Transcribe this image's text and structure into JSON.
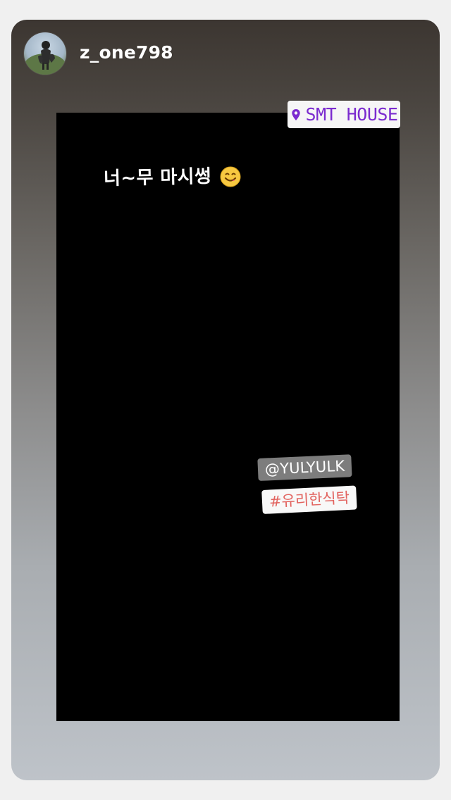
{
  "story": {
    "username": "z_one798",
    "location": "SMT HOUSE",
    "caption": "너~무 마시썽",
    "mention": "@YULYULK",
    "hashtag": "#유리한식탁"
  },
  "colors": {
    "location_text": "#7b2bcf",
    "hashtag_text": "#e2635f",
    "mention_bg": "#7d7d7d",
    "content_bg": "#000000"
  },
  "icons": {
    "location": "location-pin-icon",
    "emoji": "smiling-face-emoji-icon"
  }
}
